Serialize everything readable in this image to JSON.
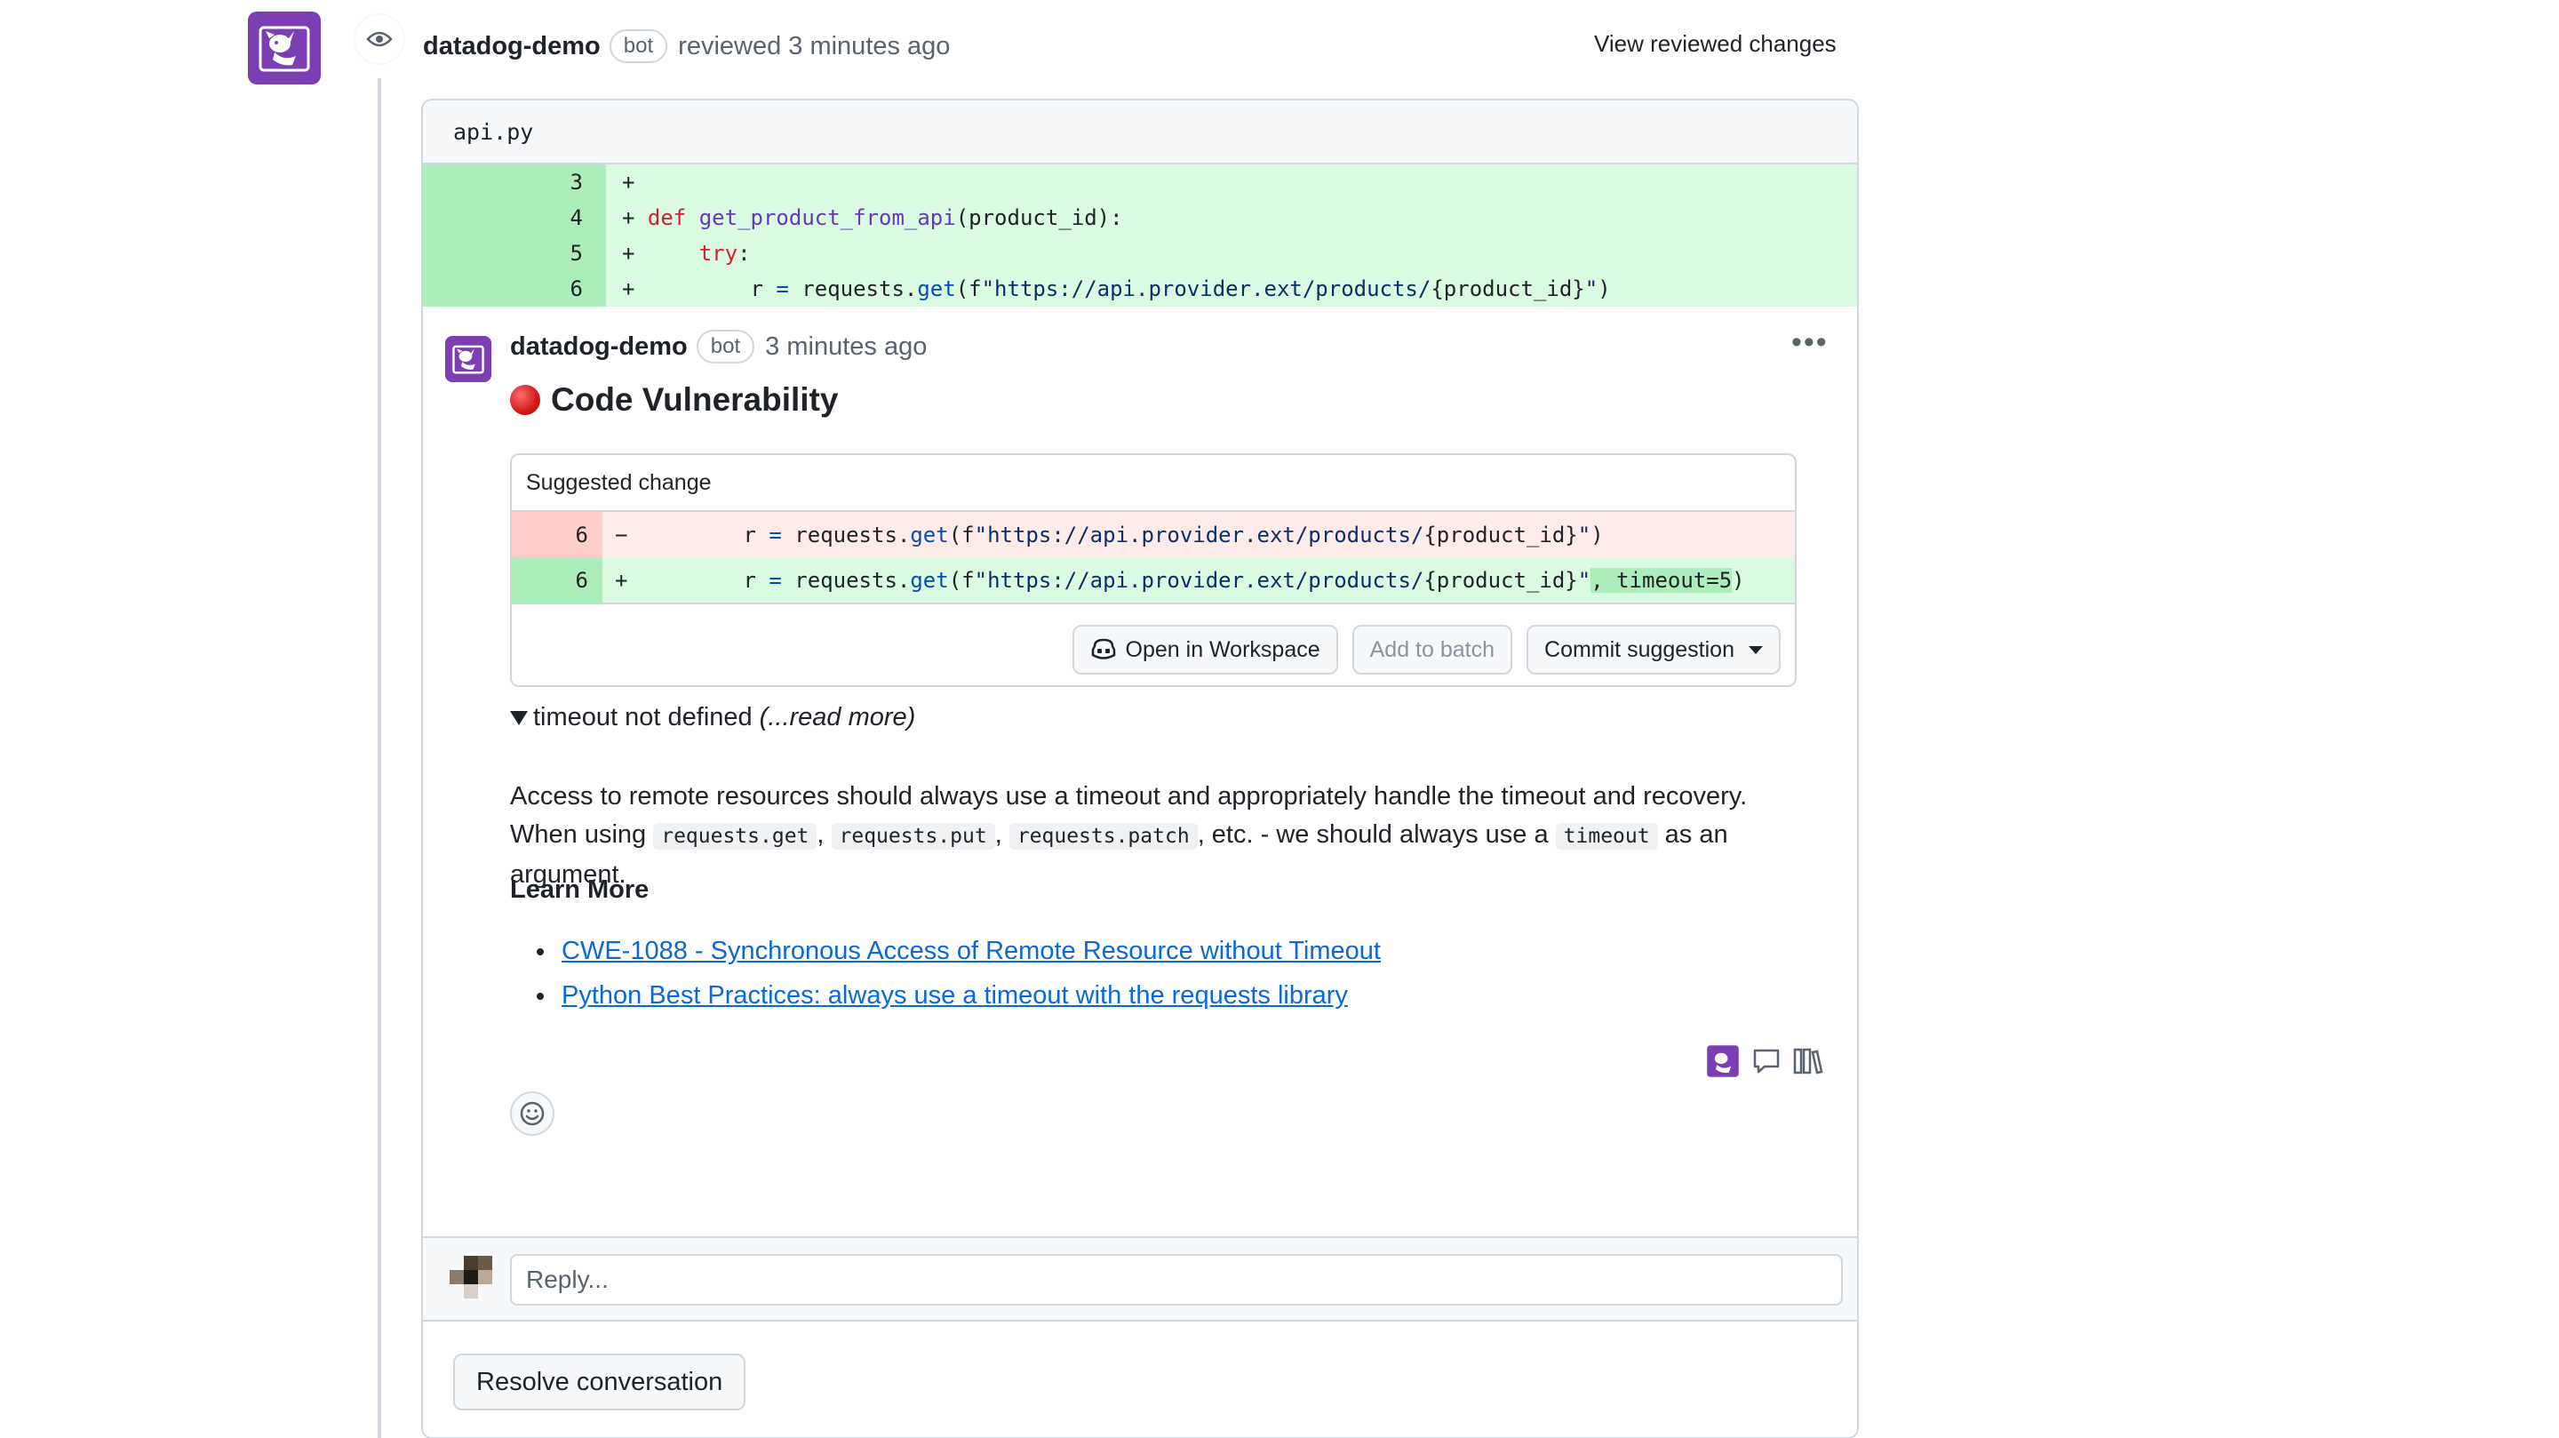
{
  "review": {
    "author": "datadog-demo",
    "bot_label": "bot",
    "action_text": "reviewed 3 minutes ago",
    "view_changes": "View reviewed changes"
  },
  "file": {
    "name": "api.py",
    "lines": [
      {
        "num": "3",
        "code": "+"
      },
      {
        "num": "4",
        "code": "+ def get_product_from_api(product_id):"
      },
      {
        "num": "5",
        "code": "+     try:"
      },
      {
        "num": "6",
        "code": "+         r = requests.get(f\"https://api.provider.ext/products/{product_id}\")"
      }
    ]
  },
  "comment": {
    "author": "datadog-demo",
    "bot_label": "bot",
    "time": "3 minutes ago",
    "title": "Code Vulnerability",
    "suggestion": {
      "header": "Suggested change",
      "removed_num": "6",
      "removed_sign": "−",
      "removed_code": "        r = requests.get(f\"https://api.provider.ext/products/{product_id}\")",
      "added_num": "6",
      "added_sign": "+",
      "added_code_a": "        r = requests.get(f\"https://api.provider.ext/products/{product_id}\"",
      "added_code_hl": ", timeout=5",
      "added_code_b": ")",
      "buttons": {
        "workspace": "Open in Workspace",
        "batch": "Add to batch",
        "commit": "Commit suggestion"
      }
    },
    "details_summary": "timeout not defined",
    "details_more": "(...read more)",
    "body": {
      "line1": "Access to remote resources should always use a timeout and appropriately handle the timeout and recovery.",
      "when_using": "When using",
      "code1": "requests.get",
      "code2": "requests.put",
      "code3": "requests.patch",
      "etc": ", etc. - we should always use a",
      "code4": "timeout",
      "as_an": "as an",
      "argument": "argument."
    },
    "learn_more": "Learn More",
    "links": [
      "CWE-1088 - Synchronous Access of Remote Resource without Timeout",
      "Python Best Practices: always use a timeout with the requests library"
    ]
  },
  "reply": {
    "placeholder": "Reply..."
  },
  "resolve_label": "Resolve conversation",
  "colors": {
    "brand_purple": "#7b3fb3",
    "add_bg": "#dafbe1",
    "del_bg": "#ffebe9",
    "link": "#0969da"
  }
}
